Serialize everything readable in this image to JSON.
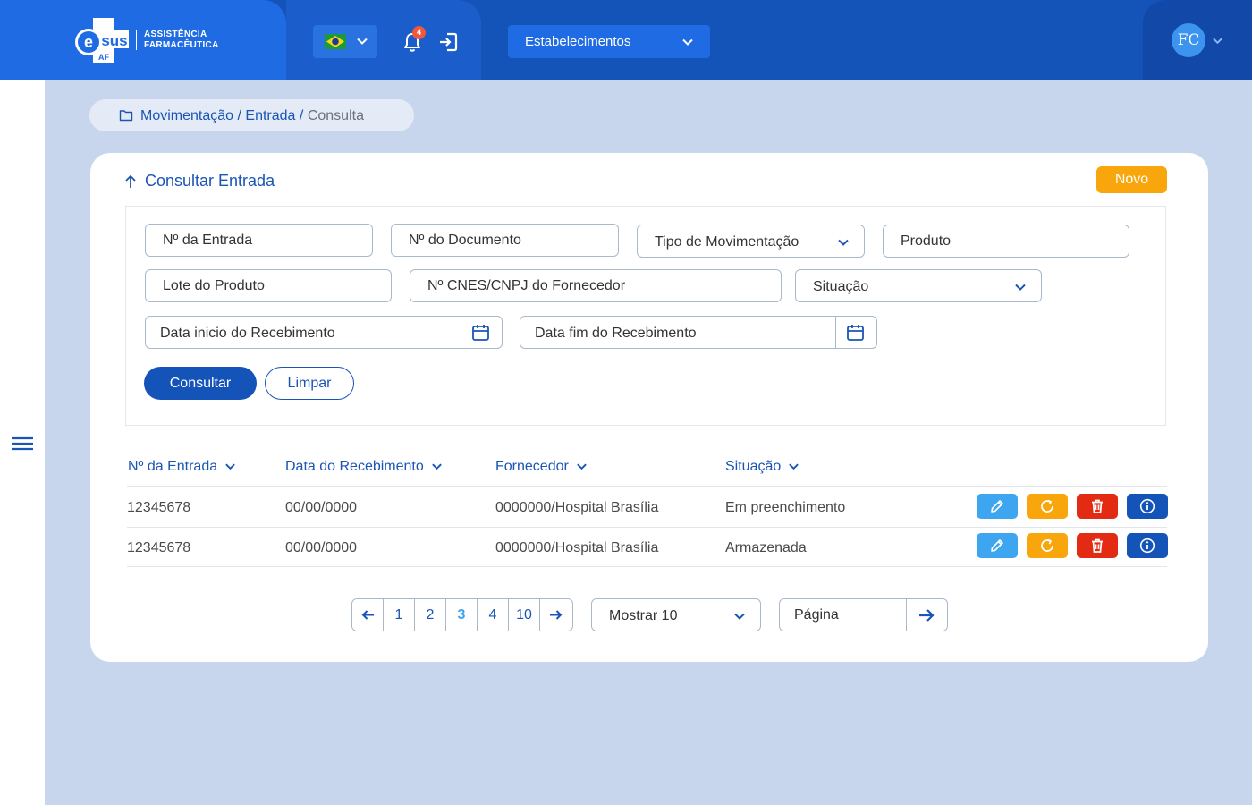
{
  "header": {
    "logo": {
      "mark": "e",
      "mark2": "sus",
      "sub": "AF",
      "text_line1": "ASSISTÊNCIA",
      "text_line2": "FARMACÊUTICA"
    },
    "notifications_count": "4",
    "establishment_label": "Estabelecimentos",
    "user_initials": "FC"
  },
  "breadcrumb": {
    "items": [
      "Movimentação",
      "Entrada",
      "Consulta"
    ],
    "separator": "/"
  },
  "card": {
    "title": "Consultar Entrada",
    "new_button": "Novo"
  },
  "filters": {
    "entry_number": "Nº da Entrada",
    "document_number": "Nº do Documento",
    "movement_type": "Tipo de  Movimentação",
    "product": "Produto",
    "product_batch": "Lote do Produto",
    "supplier_id": "Nº CNES/CNPJ do Fornecedor",
    "status": "Situação",
    "date_start": "Data inicio do Recebimento",
    "date_end": "Data fim do Recebimento",
    "search_button": "Consultar",
    "clear_button": "Limpar"
  },
  "table": {
    "columns": [
      "Nº da Entrada",
      "Data do Recebimento",
      "Fornecedor",
      "Situação"
    ],
    "rows": [
      {
        "entry": "12345678",
        "date": "00/00/0000",
        "supplier": "0000000/Hospital Brasília",
        "status": "Em preenchimento"
      },
      {
        "entry": "12345678",
        "date": "00/00/0000",
        "supplier": "0000000/Hospital Brasília",
        "status": "Armazenada"
      }
    ]
  },
  "pagination": {
    "pages": [
      "1",
      "2",
      "3",
      "4",
      "10"
    ],
    "current_page": "3",
    "page_size_label": "Mostrar 10",
    "page_input_placeholder": "Página"
  },
  "colors": {
    "primary": "#1453b8",
    "header_light": "#1f6be3",
    "background": "#c7d6ec",
    "accent_orange": "#f9a60c",
    "edit_blue": "#3ea5f0",
    "delete_red": "#e22b12"
  },
  "icons": [
    "brazil-flag-icon",
    "chevron-down-icon",
    "bell-icon",
    "logout-icon",
    "folder-icon",
    "arrow-up-icon",
    "calendar-icon",
    "pencil-icon",
    "refresh-icon",
    "trash-icon",
    "info-icon",
    "arrow-left-icon",
    "arrow-right-icon",
    "hamburger-icon"
  ]
}
